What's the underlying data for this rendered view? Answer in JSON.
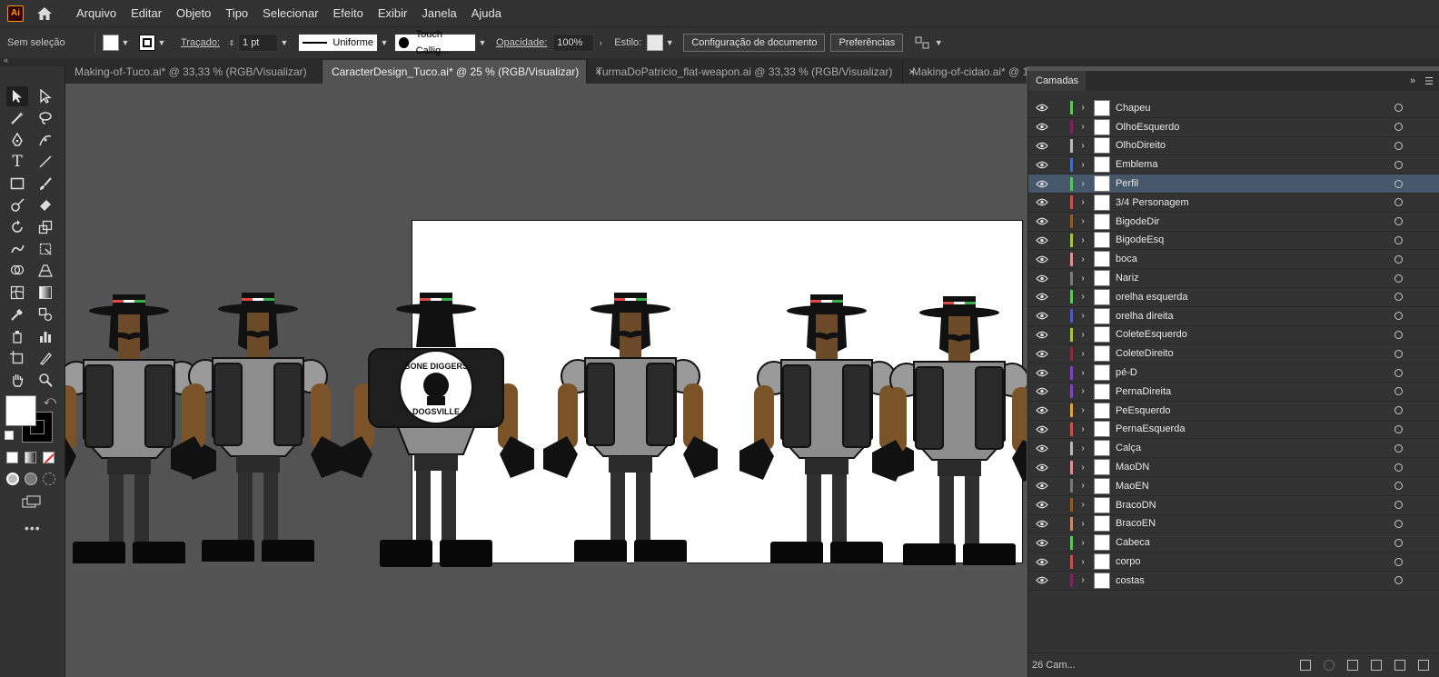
{
  "menubar": {
    "logo": "Ai",
    "items": [
      "Arquivo",
      "Editar",
      "Objeto",
      "Tipo",
      "Selecionar",
      "Efeito",
      "Exibir",
      "Janela",
      "Ajuda"
    ]
  },
  "controlbar": {
    "selection": "Sem seleção",
    "stroke_label": "Traçado:",
    "stroke_weight": "1 pt",
    "profile": "Uniforme",
    "brush": "Touch Callig...",
    "opacity_label": "Opacidade:",
    "opacity": "100%",
    "style_label": "Estilo:",
    "doc_setup": "Configuração de documento",
    "preferences": "Preferências"
  },
  "tabs": [
    {
      "label": "Making-of-Tuco.ai* @ 33,33 % (RGB/Visualizar)",
      "close": "×"
    },
    {
      "label": "CaracterDesign_Tuco.ai* @ 25 % (RGB/Visualizar)",
      "close": "×"
    },
    {
      "label": "TurmaDoPatricio_flat-weapon.ai @ 33,33 % (RGB/Visualizar)",
      "close": "×"
    },
    {
      "label": "Making-of-cidao.ai* @ 1(",
      "close": ""
    }
  ],
  "artwork": {
    "emblem_top": "BONE DIGGERS",
    "emblem_bottom": "DOGSVILLE"
  },
  "layers": {
    "title": "Camadas",
    "count": "26 Cam...",
    "items": [
      {
        "name": "Chapeu",
        "color": "#4ad34a"
      },
      {
        "name": "OlhoEsquerdo",
        "color": "#8a1a6a"
      },
      {
        "name": "OlhoDireito",
        "color": "#b9b9b9"
      },
      {
        "name": "Emblema",
        "color": "#3b6fd6"
      },
      {
        "name": "Perfil",
        "color": "#4ad34a"
      },
      {
        "name": "3/4 Personagem",
        "color": "#e04848"
      },
      {
        "name": "BigodeDir",
        "color": "#9c5a1a"
      },
      {
        "name": "BigodeEsq",
        "color": "#a9c924"
      },
      {
        "name": "boca",
        "color": "#f08a8a"
      },
      {
        "name": "Nariz",
        "color": "#7a7a7a"
      },
      {
        "name": "orelha esquerda",
        "color": "#4ad34a"
      },
      {
        "name": "orelha direita",
        "color": "#4a5ad6"
      },
      {
        "name": "ColeteEsquerdo",
        "color": "#a9c924"
      },
      {
        "name": "ColeteDireito",
        "color": "#a0223a"
      },
      {
        "name": "pé-D",
        "color": "#8a3ad6"
      },
      {
        "name": "PernaDireita",
        "color": "#8a3ad6"
      },
      {
        "name": "PeEsquerdo",
        "color": "#f0a020"
      },
      {
        "name": "PernaEsquerda",
        "color": "#e04848"
      },
      {
        "name": "Calça",
        "color": "#b9b9b9"
      },
      {
        "name": "MaoDN",
        "color": "#f08a8a"
      },
      {
        "name": "MaoEN",
        "color": "#7a7a7a"
      },
      {
        "name": "BracoDN",
        "color": "#9c5a1a"
      },
      {
        "name": "BracoEN",
        "color": "#d08a5a"
      },
      {
        "name": "Cabeca",
        "color": "#4ad34a"
      },
      {
        "name": "corpo",
        "color": "#e04848"
      },
      {
        "name": "costas",
        "color": "#8a1a6a"
      }
    ]
  }
}
